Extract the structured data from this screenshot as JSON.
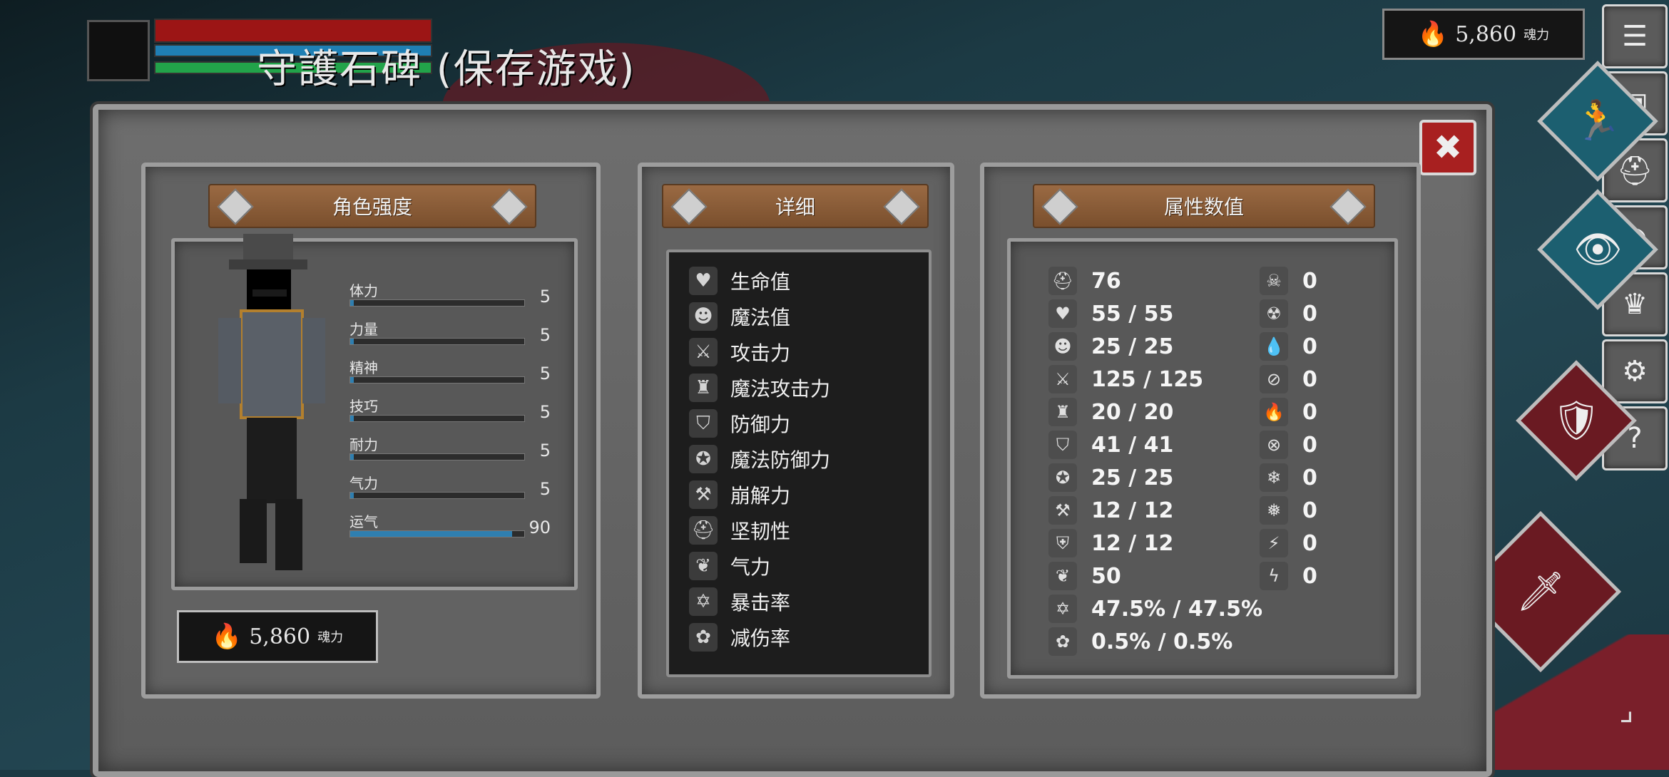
{
  "hud": {
    "save_title": "守護石碑 (保存游戏)"
  },
  "souls": {
    "amount": "5,860",
    "unit": "魂力"
  },
  "menu": {
    "icons": [
      "list-icon",
      "backpack-icon",
      "helmet-icon",
      "ring-icon",
      "crown-icon",
      "gear-icon",
      "help-icon"
    ]
  },
  "panel_titles": {
    "character": "角色强度",
    "details": "详细",
    "attributes": "属性数值"
  },
  "stats": [
    {
      "label": "体力",
      "value": "5",
      "fill": 0.02
    },
    {
      "label": "力量",
      "value": "5",
      "fill": 0.02
    },
    {
      "label": "精神",
      "value": "5",
      "fill": 0.02
    },
    {
      "label": "技巧",
      "value": "5",
      "fill": 0.02
    },
    {
      "label": "耐力",
      "value": "5",
      "fill": 0.02
    },
    {
      "label": "气力",
      "value": "5",
      "fill": 0.02
    },
    {
      "label": "运气",
      "value": "90",
      "fill": 0.93
    }
  ],
  "details": [
    {
      "label": "生命值",
      "icon": "heart-icon"
    },
    {
      "label": "魔法值",
      "icon": "head-icon"
    },
    {
      "label": "攻击力",
      "icon": "sword-icon"
    },
    {
      "label": "魔法攻击力",
      "icon": "magic-attack-icon"
    },
    {
      "label": "防御力",
      "icon": "shield-icon"
    },
    {
      "label": "魔法防御力",
      "icon": "magic-shield-icon"
    },
    {
      "label": "崩解力",
      "icon": "break-icon"
    },
    {
      "label": "坚韧性",
      "icon": "helmet-icon"
    },
    {
      "label": "气力",
      "icon": "lungs-icon"
    },
    {
      "label": "暴击率",
      "icon": "critical-icon"
    },
    {
      "label": "减伤率",
      "icon": "damage-reduction-icon"
    }
  ],
  "attributes_left": [
    {
      "icon": "helmet-icon",
      "value": "76"
    },
    {
      "icon": "heart-icon",
      "value": "55 / 55"
    },
    {
      "icon": "head-icon",
      "value": "25 / 25"
    },
    {
      "icon": "sword-icon",
      "value": "125 / 125"
    },
    {
      "icon": "magic-attack-icon",
      "value": "20 / 20"
    },
    {
      "icon": "shield-icon",
      "value": "41 / 41"
    },
    {
      "icon": "magic-shield-icon",
      "value": "25 / 25"
    },
    {
      "icon": "break-icon",
      "value": "12 / 12"
    },
    {
      "icon": "toughness-icon",
      "value": "12 / 12"
    },
    {
      "icon": "lungs-icon",
      "value": "50"
    },
    {
      "icon": "critical-icon",
      "value": "47.5% / 47.5%"
    },
    {
      "icon": "damage-reduction-icon",
      "value": "0.5% / 0.5%"
    }
  ],
  "attributes_right": [
    {
      "icon": "skull-icon",
      "value": "0"
    },
    {
      "icon": "skull-resist-icon",
      "value": "0"
    },
    {
      "icon": "blood-icon",
      "value": "0"
    },
    {
      "icon": "blood-resist-icon",
      "value": "0"
    },
    {
      "icon": "fire-icon",
      "value": "0"
    },
    {
      "icon": "fire-resist-icon",
      "value": "0"
    },
    {
      "icon": "frost-icon",
      "value": "0"
    },
    {
      "icon": "frost-resist-icon",
      "value": "0"
    },
    {
      "icon": "lightning-icon",
      "value": "0"
    },
    {
      "icon": "lightning-resist-icon",
      "value": "0"
    }
  ]
}
